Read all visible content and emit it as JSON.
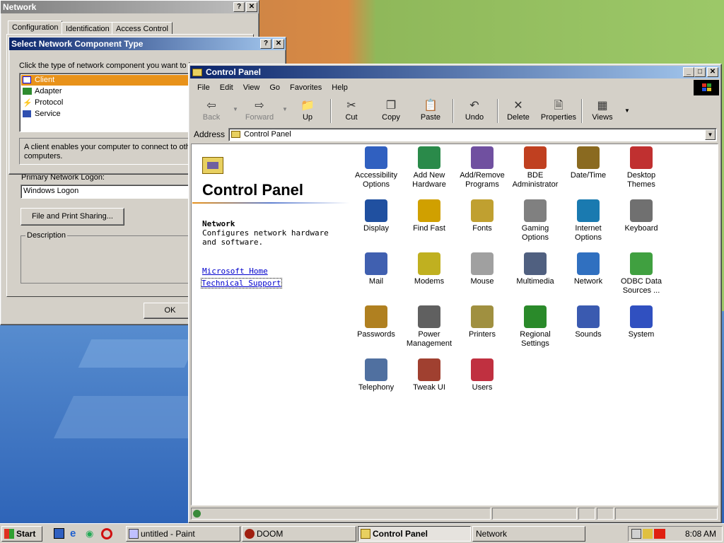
{
  "network_window": {
    "title": "Network",
    "tabs": [
      "Configuration",
      "Identification",
      "Access Control"
    ],
    "logon_label": "Primary Network Logon:",
    "logon_value": "Windows Logon",
    "file_print_button": "File and Print Sharing...",
    "description_label": "Description",
    "ok_button": "OK"
  },
  "select_dialog": {
    "title": "Select Network Component Type",
    "instruction": "Click the type of network component you want to i",
    "items": [
      "Client",
      "Adapter",
      "Protocol",
      "Service"
    ],
    "description_line1": "A client enables your computer to connect to oth",
    "description_line2": "computers."
  },
  "control_panel": {
    "title": "Control Panel",
    "menu": [
      "File",
      "Edit",
      "View",
      "Go",
      "Favorites",
      "Help"
    ],
    "toolbar": {
      "back": "Back",
      "forward": "Forward",
      "up": "Up",
      "cut": "Cut",
      "copy": "Copy",
      "paste": "Paste",
      "undo": "Undo",
      "delete": "Delete",
      "properties": "Properties",
      "views": "Views"
    },
    "address_label": "Address",
    "address_value": "Control Panel",
    "heading": "Control Panel",
    "selected_name": "Network",
    "selected_desc": "Configures network hardware and software.",
    "links": [
      "Microsoft Home",
      "Technical Support"
    ],
    "items": [
      "Accessibility Options",
      "Add New Hardware",
      "Add/Remove Programs",
      "BDE Administrator",
      "Date/Time",
      "Desktop Themes",
      "Display",
      "Find Fast",
      "Fonts",
      "Gaming Options",
      "Internet Options",
      "Keyboard",
      "Mail",
      "Modems",
      "Mouse",
      "Multimedia",
      "Network",
      "ODBC Data Sources ...",
      "Passwords",
      "Power Management",
      "Printers",
      "Regional Settings",
      "Sounds",
      "System",
      "Telephony",
      "Tweak UI",
      "Users"
    ]
  },
  "taskbar": {
    "start": "Start",
    "tasks": [
      "untitled - Paint",
      "DOOM",
      "Control Panel",
      "Network"
    ],
    "clock": "8:08 AM"
  }
}
